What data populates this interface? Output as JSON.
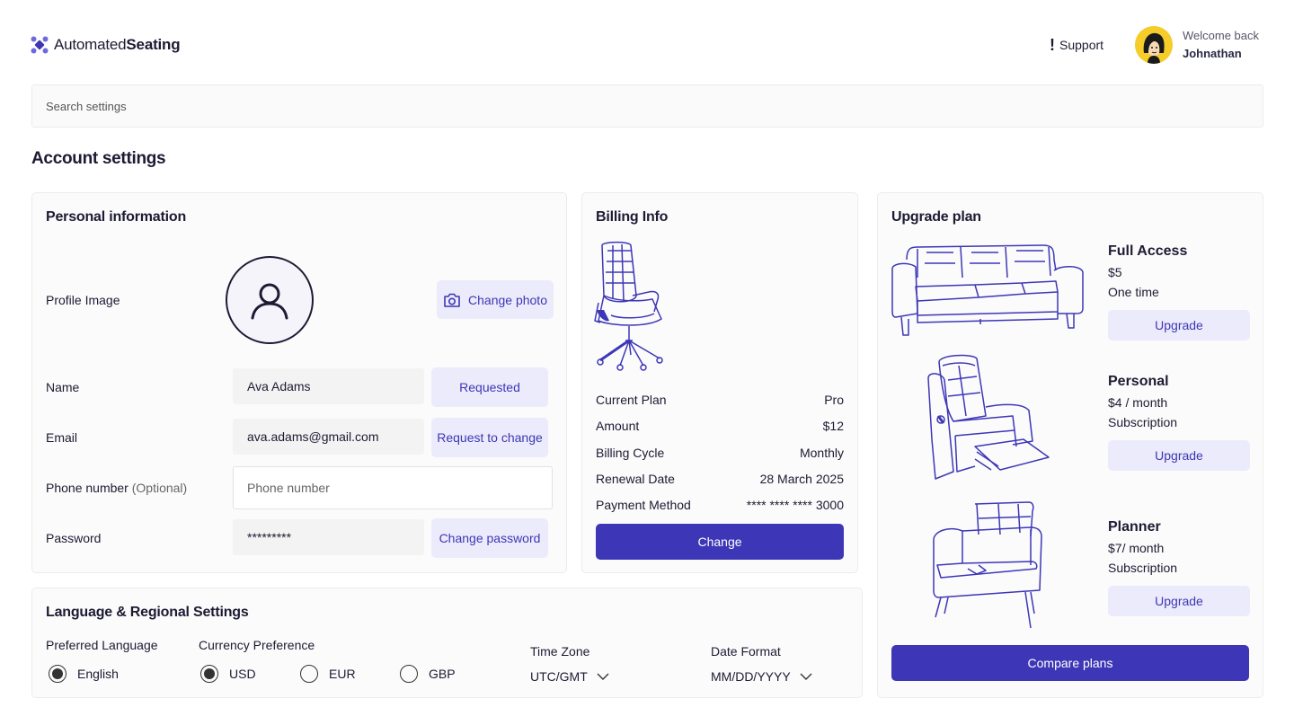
{
  "brand": {
    "name_light": "Automated",
    "name_bold": "Seating",
    "accent": "#3d37b7"
  },
  "header": {
    "support_label": "Support",
    "welcome": "Welcome back",
    "user_name": "Johnathan"
  },
  "search": {
    "placeholder": "Search settings"
  },
  "page_title": "Account settings",
  "personal": {
    "title": "Personal information",
    "profile_label": "Profile Image",
    "change_photo": "Change photo",
    "name_label": "Name",
    "name_value": "Ava Adams",
    "name_action": "Requested",
    "email_label": "Email",
    "email_value": "ava.adams@gmail.com",
    "email_action": "Request to change",
    "phone_label": "Phone number",
    "phone_optional": "(Optional)",
    "phone_placeholder": "Phone number",
    "password_label": "Password",
    "password_value": "*********",
    "password_action": "Change password"
  },
  "billing": {
    "title": "Billing Info",
    "rows": [
      {
        "label": "Current Plan",
        "value": "Pro"
      },
      {
        "label": "Amount",
        "value": "$12"
      },
      {
        "label": "Billing Cycle",
        "value": "Monthly"
      },
      {
        "label": "Renewal Date",
        "value": "28 March 2025"
      },
      {
        "label": "Payment Method",
        "value": "**** **** **** 3000"
      }
    ],
    "change_label": "Change"
  },
  "upgrade": {
    "title": "Upgrade plan",
    "plans": [
      {
        "name": "Full Access",
        "price": "$5",
        "term": "One time",
        "button": "Upgrade"
      },
      {
        "name": "Personal",
        "price": "$4 / month",
        "term": "Subscription",
        "button": "Upgrade"
      },
      {
        "name": "Planner",
        "price": "$7/ month",
        "term": "Subscription",
        "button": "Upgrade"
      }
    ],
    "compare_label": "Compare plans"
  },
  "language": {
    "title": "Language & Regional Settings",
    "pref_lang_label": "Preferred Language",
    "lang_option": "English",
    "currency_label": "Currency Preference",
    "currencies": [
      "USD",
      "EUR",
      "GBP"
    ],
    "currency_selected": "USD",
    "timezone_label": "Time Zone",
    "timezone_value": "UTC/GMT",
    "date_label": "Date Format",
    "date_value": "MM/DD/YYYY"
  }
}
